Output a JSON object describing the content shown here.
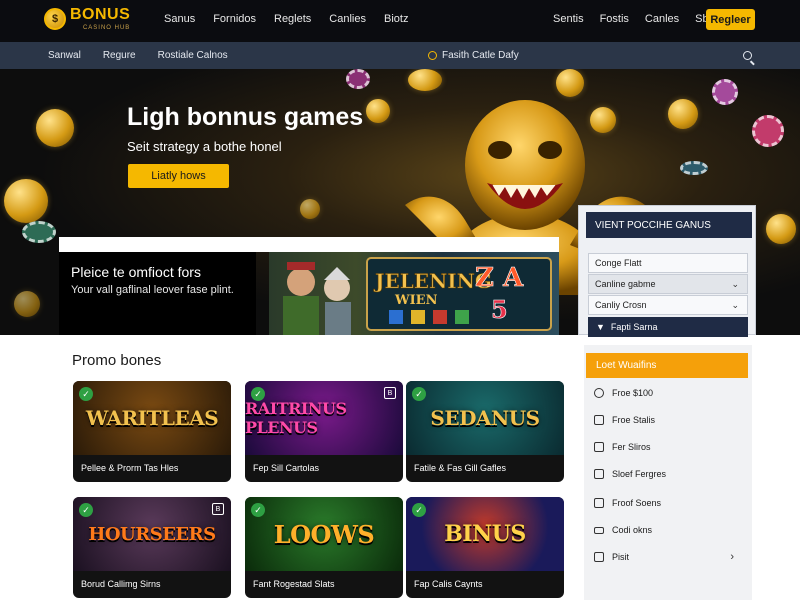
{
  "brand": {
    "name": "BONUS",
    "tagline": "CASINO HUB"
  },
  "topnav": {
    "left_links": [
      "Sanus",
      "Fornidos",
      "Reglets",
      "Canlies",
      "Biotz"
    ],
    "right_links": [
      "Sentis",
      "Fostis",
      "Canles",
      "Sbot"
    ],
    "register_label": "Regleer"
  },
  "subnav": {
    "links": [
      "Sanwal",
      "Regure",
      "Rostiale Calnos"
    ],
    "center_note": "Fasith Catle Dafy"
  },
  "hero": {
    "title": "Ligh bonnus games",
    "subtitle": "Seit strategy a bothe honel",
    "cta_label": "Liatly hows"
  },
  "info_card": {
    "title": "Pleice te omfioct fors",
    "subtitle": "Your vall gaflinal leover fase plint."
  },
  "slot_banner": {
    "line1": "JELENING",
    "line2": "WIEN",
    "symbols": "Z A",
    "number": "5"
  },
  "widget": {
    "title": "VIENT POCCIHE GANUS",
    "rows": [
      "Conge Flatt",
      "Canline gabme",
      "Canliy Crosn"
    ],
    "button_label": "Fapti Sarna"
  },
  "promo": {
    "title": "Promo bones",
    "cards": [
      {
        "art": "WARITLEAS",
        "label": "Pellee & Prorm Tas Hles",
        "accent": "#c58a1a"
      },
      {
        "art": "RAITRINUS PLENUS",
        "label": "Fep Sill Cartolas",
        "accent": "#c0147a"
      },
      {
        "art": "SEDANUS",
        "label": "Fatile & Fas Gill Gafles",
        "accent": "#1e8a6a"
      },
      {
        "art": "HOURSEERS",
        "label": "Borud Callimg Sirns",
        "accent": "#d24a12"
      },
      {
        "art": "LOOWS",
        "label": "Fant Rogestad Slats",
        "accent": "#2d7a2a"
      },
      {
        "art": "BINUS",
        "label": "Fap Calis Caynts",
        "accent": "#1d3c8a"
      }
    ]
  },
  "side_panel": {
    "title": "Loet Wuaifins",
    "items": [
      "Froe $100",
      "Froe Stalis",
      "Fer Sliros",
      "Sloef Fergres",
      "Froof Soens",
      "Codi okns",
      "Pisit"
    ]
  },
  "colors": {
    "accent": "#f5b800",
    "nav_bg": "#0b0c10",
    "subnav_bg": "#2b3648",
    "panel_orange": "#f5a00a",
    "widget_navy": "#1f2b45"
  }
}
